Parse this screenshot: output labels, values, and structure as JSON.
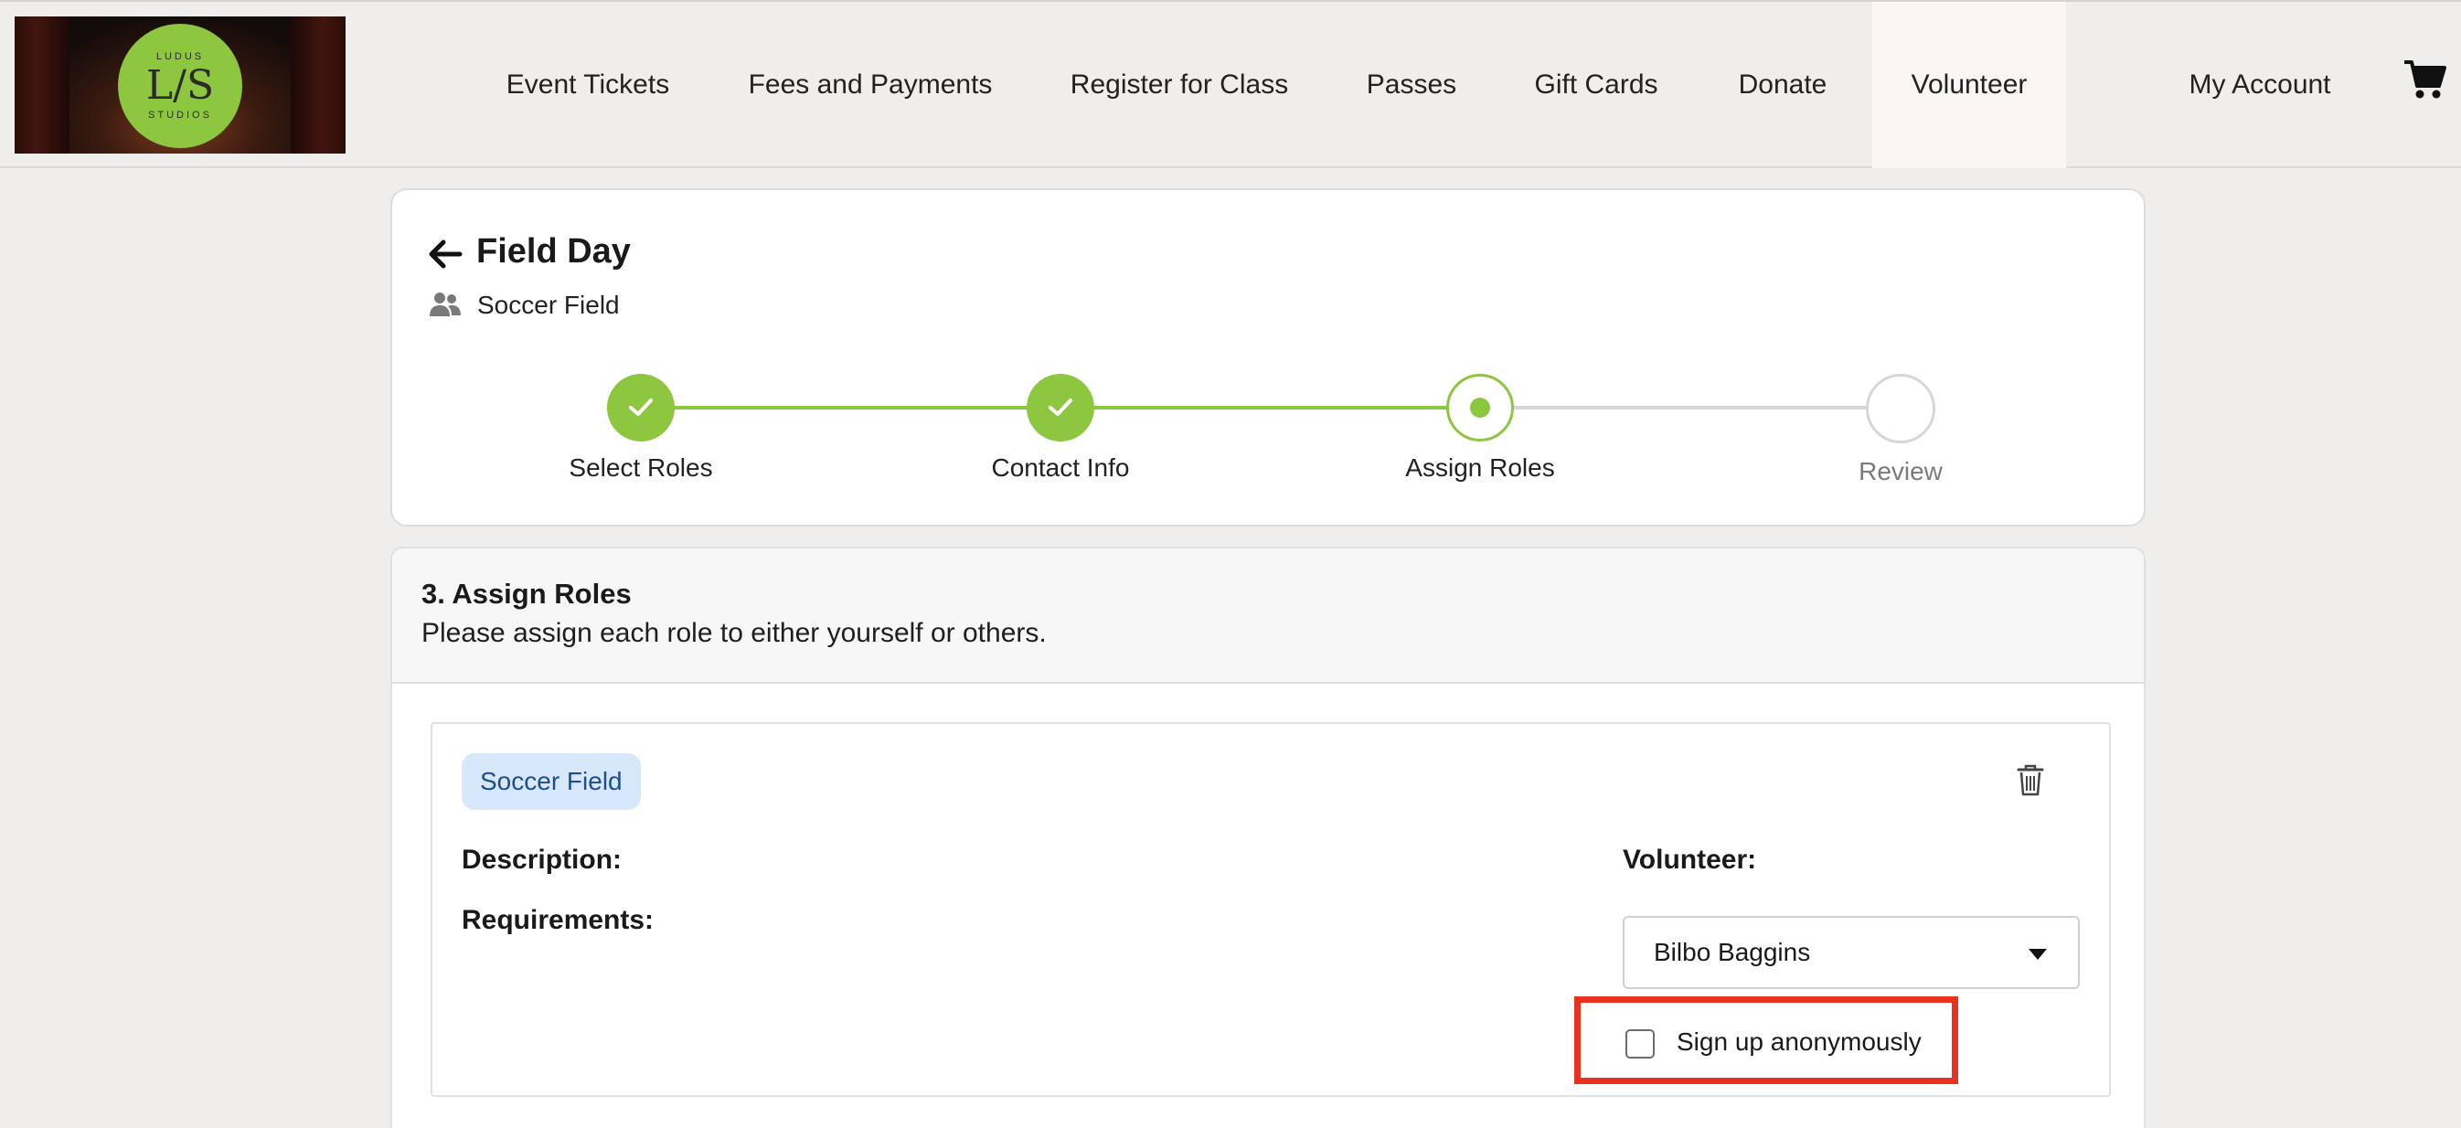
{
  "header": {
    "logo": {
      "top_text": "LUDUS",
      "monogram": "L/S",
      "bottom_text": "STUDIOS"
    },
    "nav": [
      {
        "label": "Event Tickets",
        "active": false
      },
      {
        "label": "Fees and Payments",
        "active": false
      },
      {
        "label": "Register for Class",
        "active": false
      },
      {
        "label": "Passes",
        "active": false
      },
      {
        "label": "Gift Cards",
        "active": false
      },
      {
        "label": "Donate",
        "active": false
      },
      {
        "label": "Volunteer",
        "active": true
      }
    ],
    "account_label": "My Account",
    "cart_icon": "shopping-cart-icon"
  },
  "event": {
    "title": "Field Day",
    "subtitle": "Soccer Field",
    "back_icon": "arrow-left-icon",
    "people_icon": "people-icon"
  },
  "steps": [
    {
      "label": "Select Roles",
      "status": "complete"
    },
    {
      "label": "Contact Info",
      "status": "complete"
    },
    {
      "label": "Assign Roles",
      "status": "current"
    },
    {
      "label": "Review",
      "status": "upcoming"
    }
  ],
  "section": {
    "title": "3. Assign Roles",
    "description": "Please assign each role to either yourself or others."
  },
  "role": {
    "chip": "Soccer Field",
    "description_label": "Description:",
    "requirements_label": "Requirements:",
    "volunteer_label": "Volunteer:",
    "volunteer_selected": "Bilbo Baggins",
    "anonymous_label": "Sign up anonymously",
    "anonymous_checked": false,
    "delete_icon": "trash-icon"
  },
  "colors": {
    "accent_green": "#8dc63f",
    "highlight_red": "#e8321f",
    "chip_bg": "#d8e8fb",
    "chip_text": "#1f4e89"
  }
}
